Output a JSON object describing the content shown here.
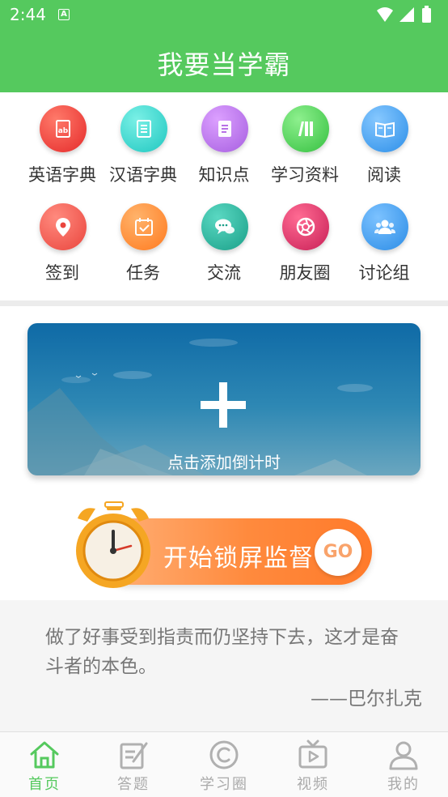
{
  "status_bar": {
    "time": "2:44",
    "notification_badge": "A"
  },
  "header": {
    "title": "我要当学霸"
  },
  "grid": {
    "items": [
      {
        "label": "英语字典",
        "icon": "dictionary-en-icon",
        "color": "#f04545"
      },
      {
        "label": "汉语字典",
        "icon": "dictionary-zh-icon",
        "color": "#3dd8cc"
      },
      {
        "label": "知识点",
        "icon": "knowledge-icon",
        "color": "#b770e6"
      },
      {
        "label": "学习资料",
        "icon": "books-icon",
        "color": "#4fcc5a"
      },
      {
        "label": "阅读",
        "icon": "reading-icon",
        "color": "#3ea3ee"
      },
      {
        "label": "签到",
        "icon": "location-pin-icon",
        "color": "#f05a52"
      },
      {
        "label": "任务",
        "icon": "calendar-check-icon",
        "color": "#ff8a33"
      },
      {
        "label": "交流",
        "icon": "chat-icon",
        "color": "#2bb39c"
      },
      {
        "label": "朋友圈",
        "icon": "aperture-icon",
        "color": "#e23a6a"
      },
      {
        "label": "讨论组",
        "icon": "group-icon",
        "color": "#3a9ef0"
      }
    ]
  },
  "timer_card": {
    "label": "点击添加倒计时"
  },
  "lock_button": {
    "label": "开始锁屏监督",
    "go": "GO"
  },
  "quote": {
    "text": "做了好事受到指责而仍坚持下去，这才是奋斗者的本色。",
    "author": "——巴尔扎克"
  },
  "bottom_nav": {
    "items": [
      {
        "label": "首页",
        "icon": "home-icon",
        "active": true
      },
      {
        "label": "答题",
        "icon": "quiz-icon",
        "active": false
      },
      {
        "label": "学习圈",
        "icon": "circle-c-icon",
        "active": false
      },
      {
        "label": "视频",
        "icon": "tv-icon",
        "active": false
      },
      {
        "label": "我的",
        "icon": "person-icon",
        "active": false
      }
    ]
  },
  "colors": {
    "brand": "#55c95e",
    "accent": "#ff8a3d"
  }
}
